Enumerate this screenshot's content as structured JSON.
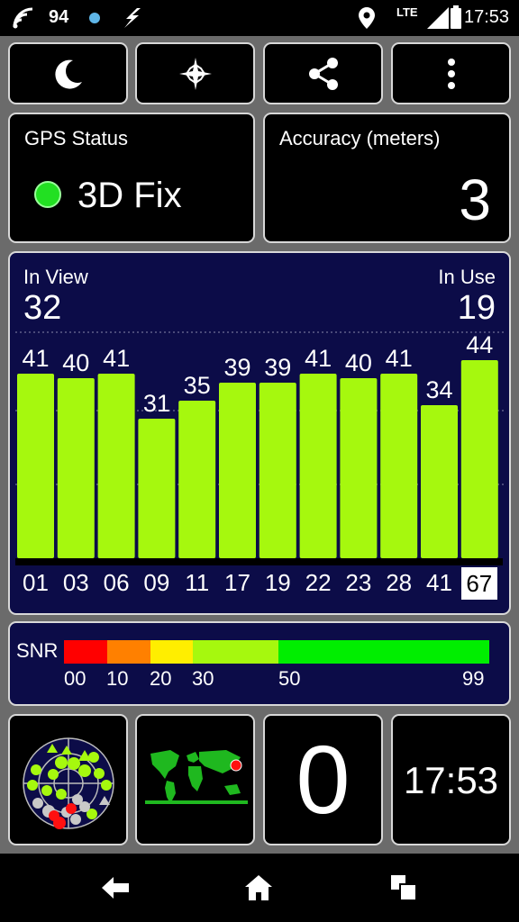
{
  "status_bar": {
    "notification_count": "94",
    "network_type": "LTE",
    "time": "17:53",
    "icons": [
      "wifi-icon",
      "dot-icon",
      "bolt-icon",
      "location-icon",
      "signal-icon",
      "battery-icon"
    ]
  },
  "toolbar": {
    "buttons": [
      "moon-icon",
      "compass-icon",
      "share-icon",
      "more-vert-icon"
    ]
  },
  "gps_status": {
    "title": "GPS Status",
    "value": "3D Fix",
    "indicator_color": "#22e022"
  },
  "accuracy": {
    "title": "Accuracy (meters)",
    "value": "3"
  },
  "satellites": {
    "in_view_label": "In View",
    "in_view_value": "32",
    "in_use_label": "In Use",
    "in_use_value": "19"
  },
  "chart_data": {
    "type": "bar",
    "categories": [
      "01",
      "03",
      "06",
      "09",
      "11",
      "17",
      "19",
      "22",
      "23",
      "28",
      "41",
      "67"
    ],
    "values": [
      41,
      40,
      41,
      31,
      35,
      39,
      39,
      41,
      40,
      41,
      34,
      44
    ],
    "highlighted_category": "67",
    "bar_color": "#a6f80e",
    "ylim": [
      0,
      50
    ]
  },
  "snr_legend": {
    "label": "SNR",
    "ticks": [
      "00",
      "10",
      "20",
      "30",
      "50",
      "99"
    ],
    "colors": [
      "#ff0000",
      "#ff8000",
      "#ffee00",
      "#a6f80e",
      "#00ee00"
    ]
  },
  "bottom": {
    "count_value": "0",
    "clock": "17:53",
    "icons": [
      "skyplot-icon",
      "world-map-icon"
    ]
  },
  "nav": {
    "icons": [
      "back-icon",
      "home-icon",
      "recents-icon"
    ]
  }
}
